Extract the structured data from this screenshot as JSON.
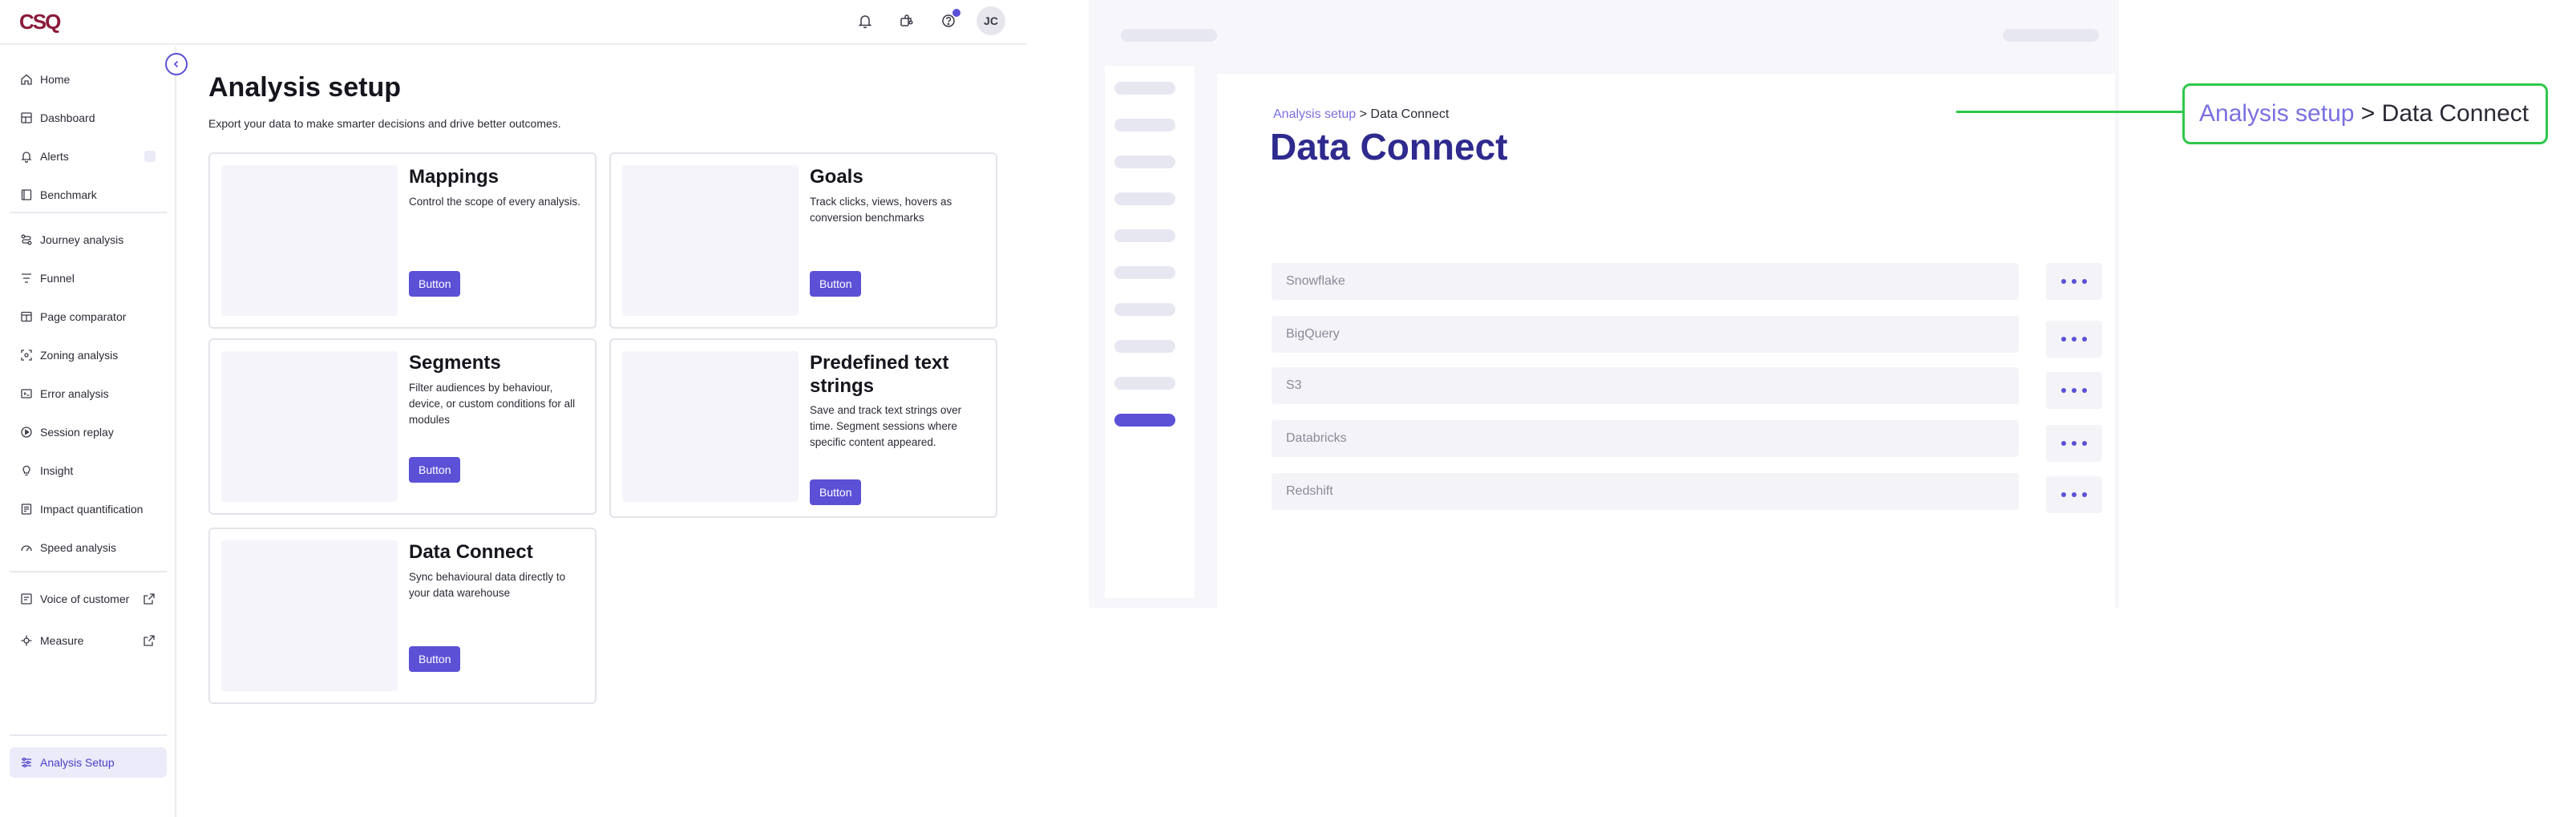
{
  "header": {
    "logo_text": "CSQ",
    "avatar_initials": "JC",
    "icons": [
      "bell-icon",
      "puzzle-icon",
      "help-icon"
    ]
  },
  "sidebar": {
    "items": [
      {
        "label": "Home",
        "icon": "home-icon"
      },
      {
        "label": "Dashboard",
        "icon": "dashboard-icon"
      },
      {
        "label": "Alerts",
        "icon": "bell-icon"
      },
      {
        "label": "Benchmark",
        "icon": "benchmark-icon"
      },
      {
        "label": "Journey analysis",
        "icon": "journey-icon"
      },
      {
        "label": "Funnel",
        "icon": "funnel-icon"
      },
      {
        "label": "Page comparator",
        "icon": "compare-icon"
      },
      {
        "label": "Zoning analysis",
        "icon": "zoning-icon"
      },
      {
        "label": "Error analysis",
        "icon": "error-icon"
      },
      {
        "label": "Session replay",
        "icon": "play-icon"
      },
      {
        "label": "Insight",
        "icon": "bulb-icon"
      },
      {
        "label": "Impact quantification",
        "icon": "impact-icon"
      },
      {
        "label": "Speed analysis",
        "icon": "gauge-icon"
      },
      {
        "label": "Voice of customer",
        "icon": "voc-icon"
      },
      {
        "label": "Measure",
        "icon": "measure-icon"
      }
    ],
    "active": {
      "label": "Analysis Setup",
      "icon": "settings-sliders-icon"
    }
  },
  "main": {
    "title": "Analysis setup",
    "subtitle": "Export your data to make smarter decisions and drive better outcomes.",
    "cards": [
      {
        "title": "Mappings",
        "description": "Control the scope of every analysis.",
        "button": "Button"
      },
      {
        "title": "Goals",
        "description": "Track clicks, views, hovers as conversion benchmarks",
        "button": "Button"
      },
      {
        "title": "Segments",
        "description": "Filter audiences by behaviour, device, or custom conditions for all modules",
        "button": "Button"
      },
      {
        "title": "Predefined text strings",
        "description": "Save and track text strings over time. Segment sessions where specific content appeared.",
        "button": "Button"
      },
      {
        "title": "Data Connect",
        "description": "Sync behavioural data directly to your data warehouse",
        "button": "Button"
      }
    ]
  },
  "mock": {
    "breadcrumb": {
      "parent": "Analysis setup",
      "separator": ">",
      "current": "Data Connect"
    },
    "title": "Data Connect",
    "rows": [
      "Snowflake",
      "BigQuery",
      "S3",
      "Databricks",
      "Redshift"
    ]
  },
  "callout": {
    "parent": "Analysis setup",
    "separator": ">",
    "current": "Data Connect"
  },
  "colors": {
    "accent": "#5b50d6",
    "callout_border": "#2ec84a",
    "title_navy": "#2f2a8e",
    "breadcrumb_link": "#7a70e0"
  }
}
